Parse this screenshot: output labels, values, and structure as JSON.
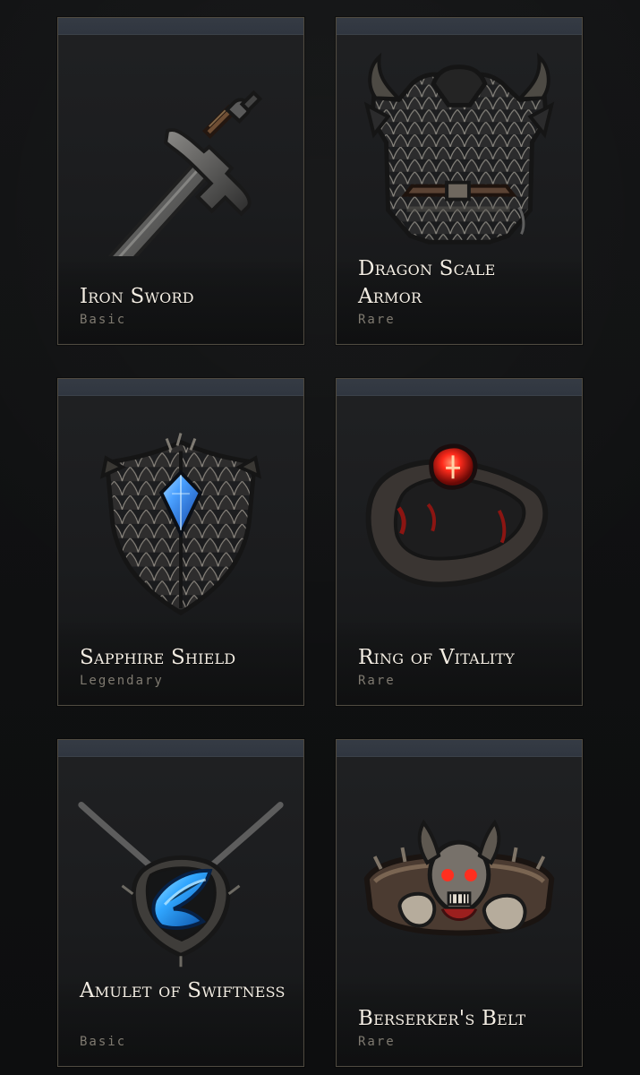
{
  "items": [
    {
      "name": "Iron Sword",
      "rarity": "Basic",
      "icon": "sword-icon"
    },
    {
      "name": "Dragon Scale Armor",
      "rarity": "Rare",
      "icon": "armor-icon"
    },
    {
      "name": "Sapphire Shield",
      "rarity": "Legendary",
      "icon": "shield-icon"
    },
    {
      "name": "Ring of Vitality",
      "rarity": "Rare",
      "icon": "ring-icon"
    },
    {
      "name": "Amulet of Swiftness",
      "rarity": "Basic",
      "icon": "amulet-icon"
    },
    {
      "name": "Berserker's Belt",
      "rarity": "Rare",
      "icon": "belt-icon"
    }
  ],
  "colors": {
    "background": "#0f1011",
    "card_border": "#4f4a40",
    "card_header": "#303640",
    "title_text": "#f3ede3",
    "rarity_text": "#7f7a70",
    "sapphire": "#2f7dff",
    "ruby": "#d7261f"
  }
}
